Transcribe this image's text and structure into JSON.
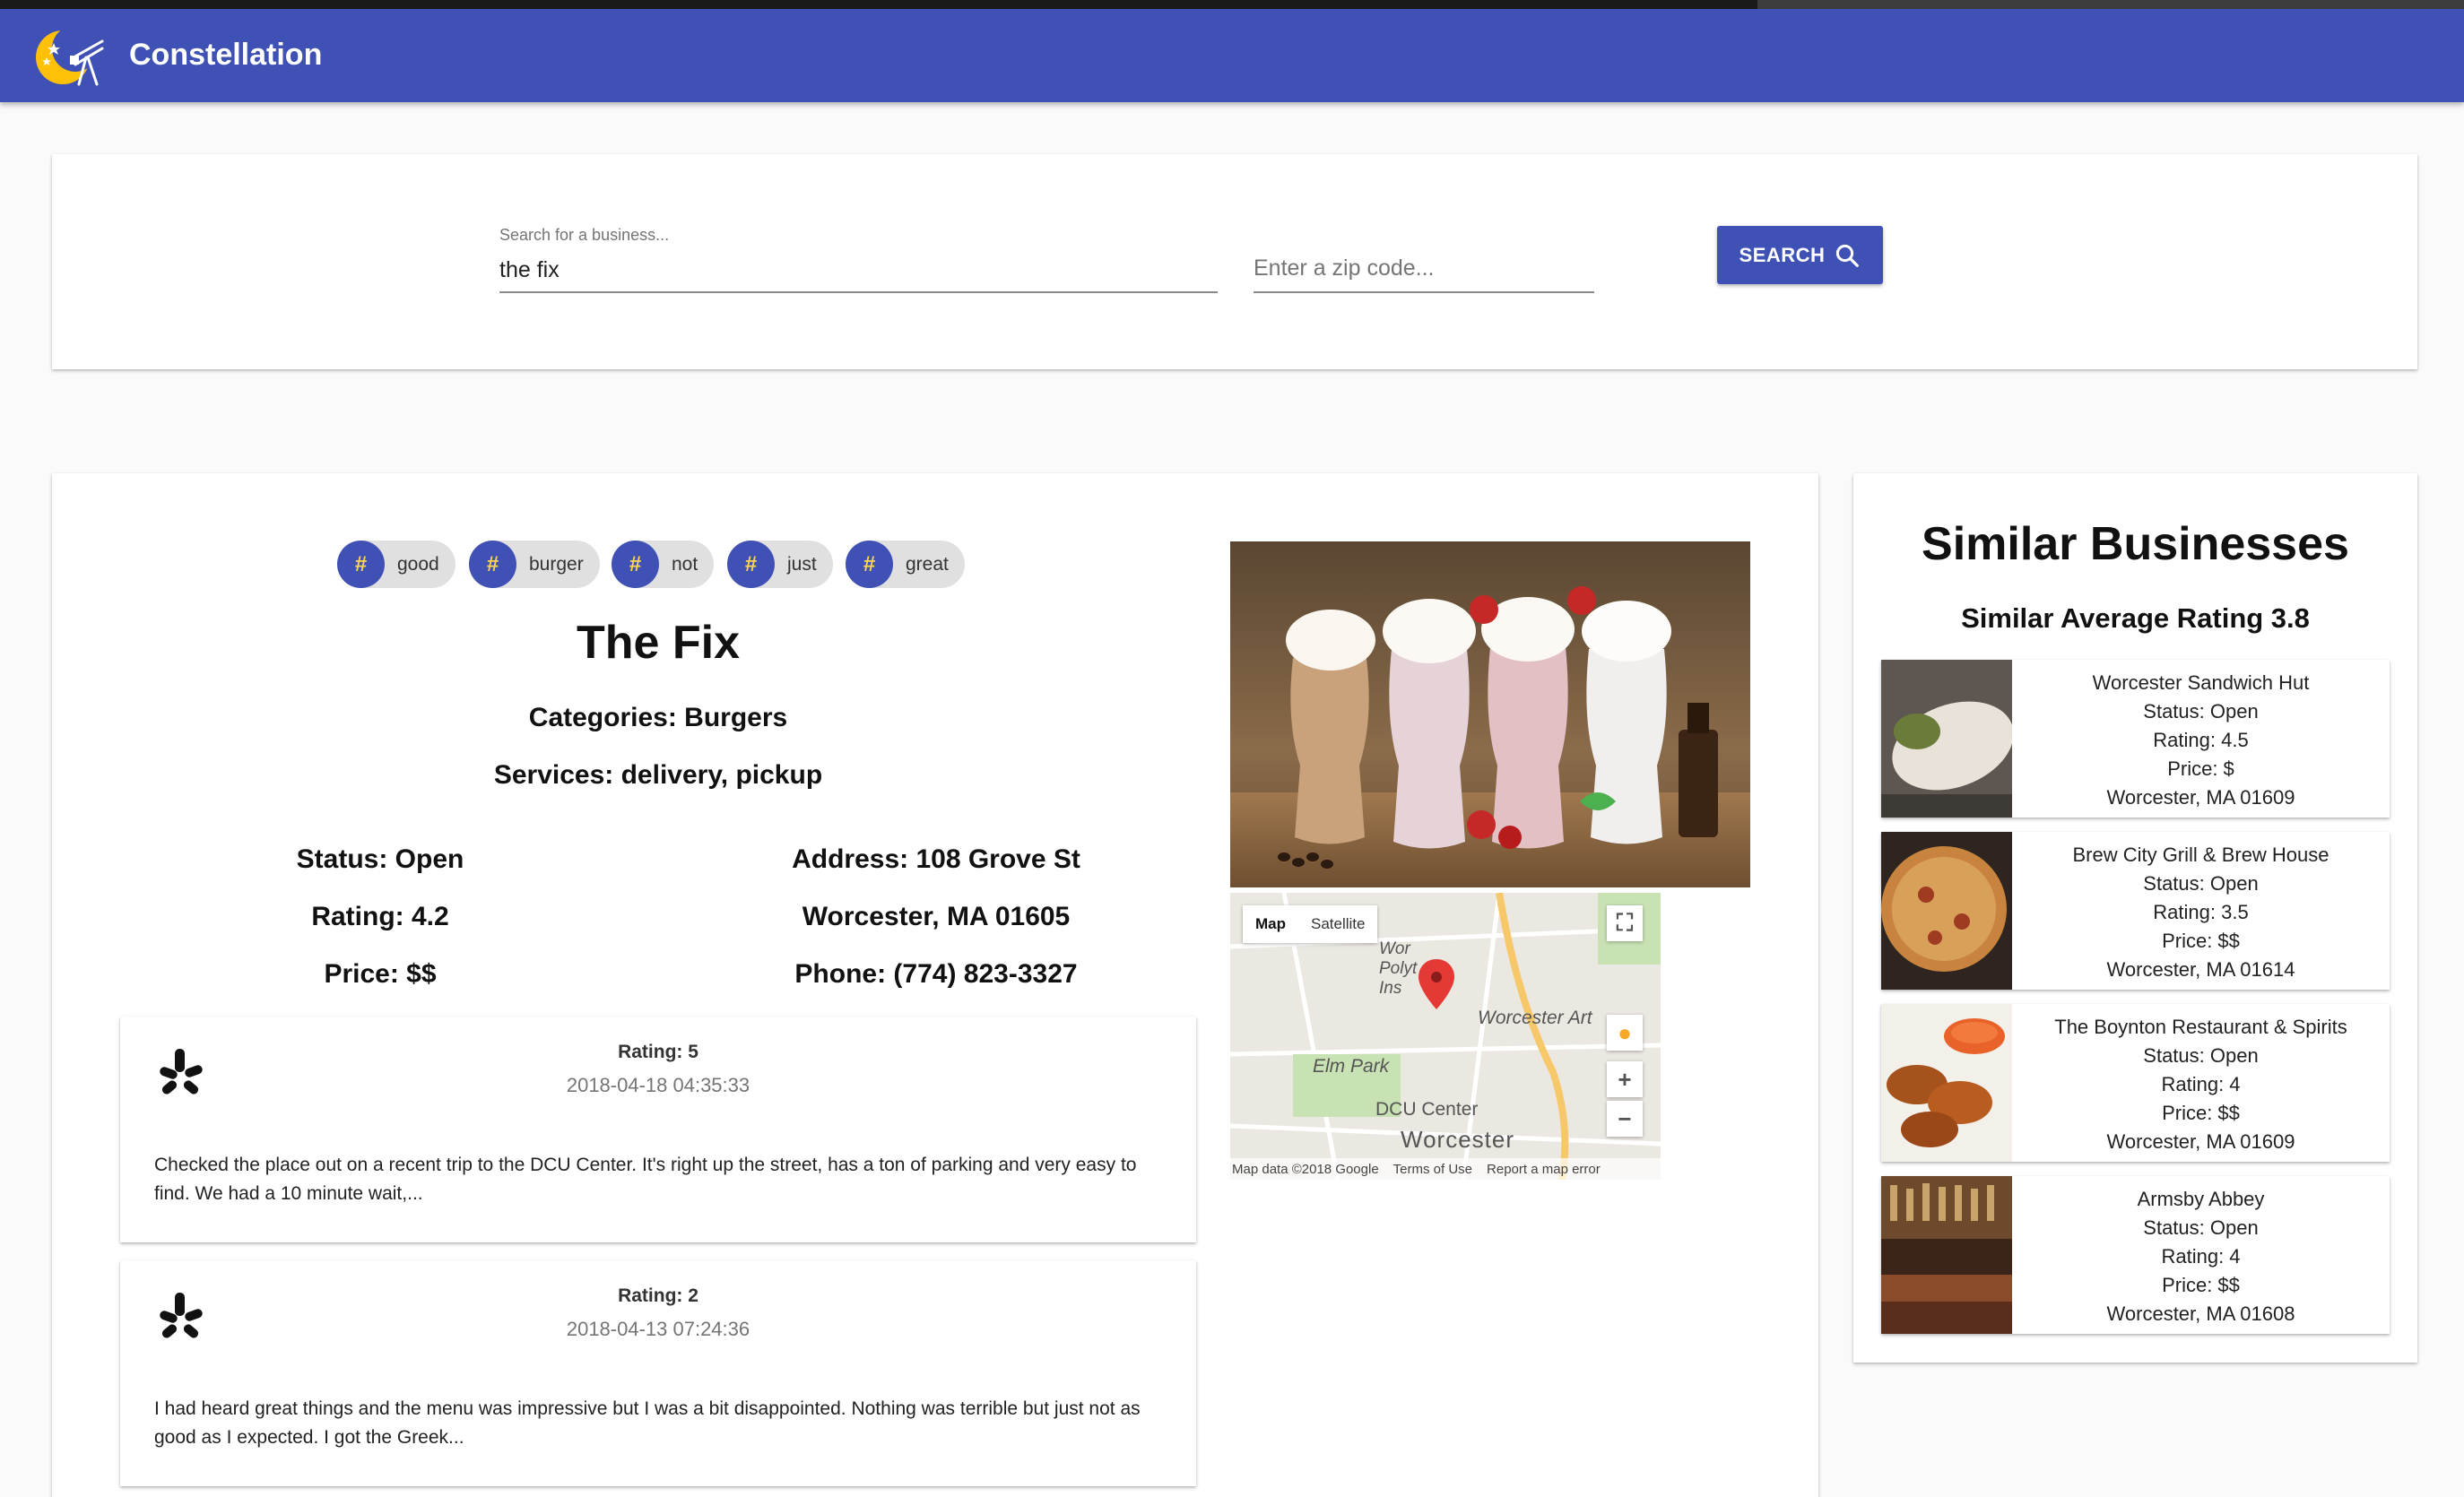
{
  "app": {
    "title": "Constellation"
  },
  "search": {
    "business_label": "Search for a business...",
    "business_value": "the fix",
    "zip_placeholder": "Enter a zip code...",
    "button_label": "SEARCH"
  },
  "business": {
    "tags": [
      "good",
      "burger",
      "not",
      "just",
      "great"
    ],
    "name": "The Fix",
    "categories": "Categories: Burgers",
    "services": "Services: delivery, pickup",
    "status": "Status: Open",
    "rating": "Rating: 4.2",
    "price": "Price: $$",
    "address": "Address: 108 Grove St",
    "city": "Worcester, MA 01605",
    "phone": "Phone: (774) 823-3327"
  },
  "reviews": [
    {
      "rating": "Rating: 5",
      "date": "2018-04-18 04:35:33",
      "text": "Checked the place out on a recent trip to the DCU Center. It's right up the street, has a ton of parking and very easy to find. We had a 10 minute wait,..."
    },
    {
      "rating": "Rating: 2",
      "date": "2018-04-13 07:24:36",
      "text": "I had heard great things and the menu was impressive but I was a bit disappointed. Nothing was terrible but just not as good as I expected. I got the Greek..."
    }
  ],
  "map": {
    "tab_map": "Map",
    "tab_satellite": "Satellite",
    "label_worcester_art": "Worcester Art",
    "label_elm_park": "Elm Park",
    "label_dcu_center": "DCU Center",
    "label_worcester": "Worcester",
    "label_poly": "Wor Polyt Ins",
    "footer_data": "Map data ©2018 Google",
    "footer_terms": "Terms of Use",
    "footer_report": "Report a map error"
  },
  "similar": {
    "title": "Similar Businesses",
    "subtitle": "Similar Average Rating 3.8",
    "items": [
      {
        "name": "Worcester Sandwich Hut",
        "status": "Status: Open",
        "rating": "Rating: 4.5",
        "price": "Price: $",
        "location": "Worcester, MA 01609"
      },
      {
        "name": "Brew City Grill & Brew House",
        "status": "Status: Open",
        "rating": "Rating: 3.5",
        "price": "Price: $$",
        "location": "Worcester, MA 01614"
      },
      {
        "name": "The Boynton Restaurant & Spirits",
        "status": "Status: Open",
        "rating": "Rating: 4",
        "price": "Price: $$",
        "location": "Worcester, MA 01609"
      },
      {
        "name": "Armsby Abbey",
        "status": "Status: Open",
        "rating": "Rating: 4",
        "price": "Price: $$",
        "location": "Worcester, MA 01608"
      }
    ]
  },
  "colors": {
    "primary": "#3f51b5",
    "accent": "#ffd54f",
    "tag_bg": "#e0e0e0",
    "pin": "#e53935"
  }
}
